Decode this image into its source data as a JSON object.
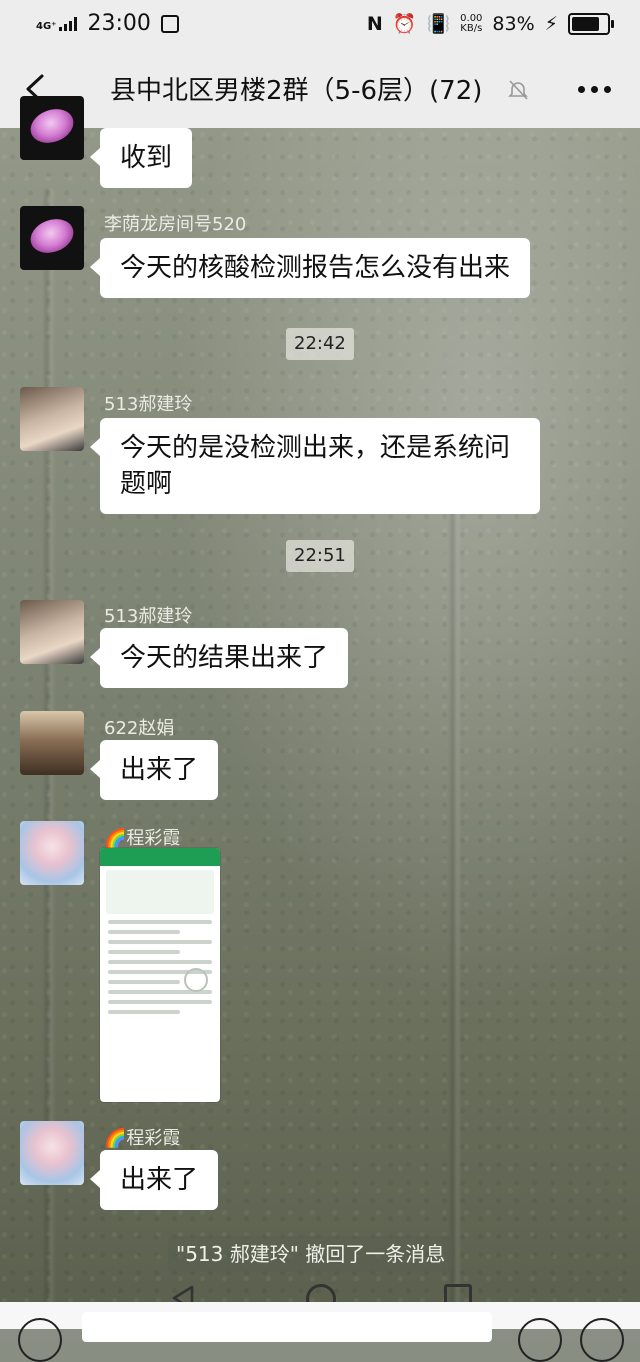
{
  "status_bar": {
    "network": "4G⁺",
    "time": "23:00",
    "speed_value": "0.00",
    "speed_unit": "KB/s",
    "battery": "83%",
    "icons": [
      "signal-icon",
      "message-icon",
      "nfc-icon",
      "alarm-icon",
      "vibrate-icon",
      "charging-icon",
      "battery-icon"
    ]
  },
  "header": {
    "title": "县中北区男楼2群（5-6层）(72)",
    "icons": [
      "back-icon",
      "mute-icon",
      "more-icon"
    ]
  },
  "messages": [
    {
      "sender": "",
      "text": "收到"
    },
    {
      "sender": "李荫龙房间号520",
      "text": "今天的核酸检测报告怎么没有出来"
    },
    {
      "timestamp": "22:42"
    },
    {
      "sender": "513郝建玲",
      "text": "今天的是没检测出来，还是系统问题啊"
    },
    {
      "timestamp": "22:51"
    },
    {
      "sender": "513郝建玲",
      "text": "今天的结果出来了"
    },
    {
      "sender": "622赵娟",
      "text": "出来了"
    },
    {
      "sender": "🌈程彩霞",
      "type": "image"
    },
    {
      "sender": "🌈程彩霞",
      "text": "出来了"
    }
  ],
  "recall_notice": "\"513 郝建玲\" 撤回了一条消息",
  "nav_icons": [
    "nav-back-icon",
    "nav-home-icon",
    "nav-recent-icon"
  ]
}
